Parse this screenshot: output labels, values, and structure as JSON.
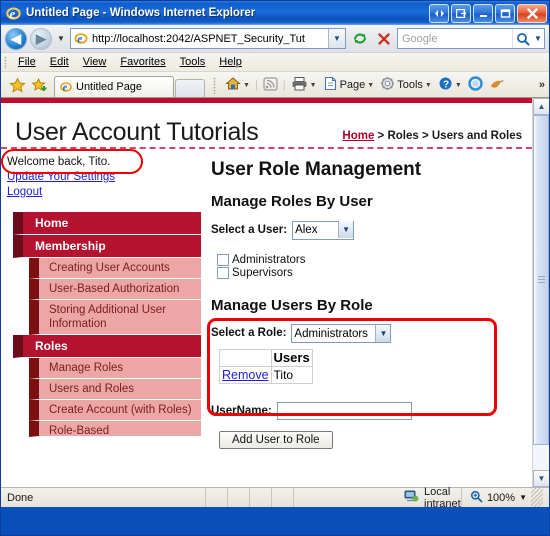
{
  "window": {
    "title": "Untitled Page - Windows Internet Explorer",
    "buttons": {
      "restore_group": "◂▸",
      "new_window": "❐",
      "minimize": "–",
      "maximize": "☐",
      "close": "✕"
    }
  },
  "address_bar": {
    "back": "◀",
    "forward": "▶",
    "history_caret": "▼",
    "url": "http://localhost:2042/ASPNET_Security_Tut",
    "url_caret": "▼",
    "refresh": "refresh-icon",
    "stop": "✕",
    "search_placeholder": "Google",
    "search_value": "",
    "search_caret": "▼"
  },
  "menu": {
    "items": [
      {
        "label": "File",
        "accel": "F"
      },
      {
        "label": "Edit",
        "accel": "E"
      },
      {
        "label": "View",
        "accel": "V"
      },
      {
        "label": "Favorites",
        "accel": "a"
      },
      {
        "label": "Tools",
        "accel": "T"
      },
      {
        "label": "Help",
        "accel": "H"
      }
    ]
  },
  "tabbar": {
    "tab_label": "Untitled Page",
    "commands": [
      {
        "label": "",
        "icon": "home-icon",
        "caret": "▼"
      },
      {
        "label": "",
        "icon": "feeds-icon",
        "caret": ""
      },
      {
        "label": "",
        "icon": "print-icon",
        "caret": "▼"
      },
      {
        "label": "Page",
        "icon": "page-icon",
        "caret": "▼"
      },
      {
        "label": "Tools",
        "icon": "tools-icon",
        "caret": "▼"
      },
      {
        "label": "",
        "icon": "help-icon",
        "caret": "▼"
      },
      {
        "label": "",
        "icon": "messenger-icon",
        "caret": ""
      },
      {
        "label": "",
        "icon": "bird-icon",
        "caret": ""
      }
    ],
    "overflow": "»"
  },
  "page": {
    "site_title": "User Account Tutorials",
    "breadcrumb": {
      "home": "Home",
      "trail": " > Roles > Users and Roles"
    },
    "welcome": {
      "greeting": "Welcome back, Tito.",
      "links": [
        "Update Your Settings",
        "Logout"
      ]
    },
    "nav": [
      {
        "label": "Home",
        "level": "top"
      },
      {
        "label": "Membership",
        "level": "top"
      },
      {
        "label": "Creating User Accounts",
        "level": "sub"
      },
      {
        "label": "User-Based Authorization",
        "level": "sub"
      },
      {
        "label": "Storing Additional User Information",
        "level": "sub"
      },
      {
        "label": "Roles",
        "level": "top"
      },
      {
        "label": "Manage Roles",
        "level": "sub"
      },
      {
        "label": "Users and Roles",
        "level": "sub"
      },
      {
        "label": "Create Account (with Roles)",
        "level": "sub"
      },
      {
        "label": "Role-Based",
        "level": "sub"
      }
    ],
    "heading": "User Role Management",
    "section_roles_by_user": {
      "heading": "Manage Roles By User",
      "select_label": "Select a User:",
      "select_value": "Alex",
      "select_options": [
        "Alex"
      ],
      "checkboxes": [
        {
          "label": "Administrators",
          "checked": false
        },
        {
          "label": "Supervisors",
          "checked": false
        }
      ]
    },
    "section_users_by_role": {
      "heading": "Manage Users By Role",
      "select_label": "Select a Role:",
      "select_value": "Administrators",
      "select_options": [
        "Administrators"
      ],
      "table": {
        "headers": [
          "",
          "Users"
        ],
        "rows": [
          {
            "action": "Remove",
            "user": "Tito"
          }
        ]
      },
      "username_label": "UserName:",
      "username_value": "",
      "add_button": "Add User to Role"
    }
  },
  "statusbar": {
    "status": "Done",
    "zone": "Local intranet",
    "zoom": "100%",
    "zoom_caret": "▼"
  },
  "colors": {
    "title_bar_blue": "#0d5fd6",
    "site_red": "#c00a2e",
    "nav_top_bg": "#b5122f",
    "nav_sub_bg": "#eda6a6",
    "annotation_red": "#ee0000",
    "link_blue": "#2020dd",
    "breadcrumb_link": "#b0002a"
  }
}
